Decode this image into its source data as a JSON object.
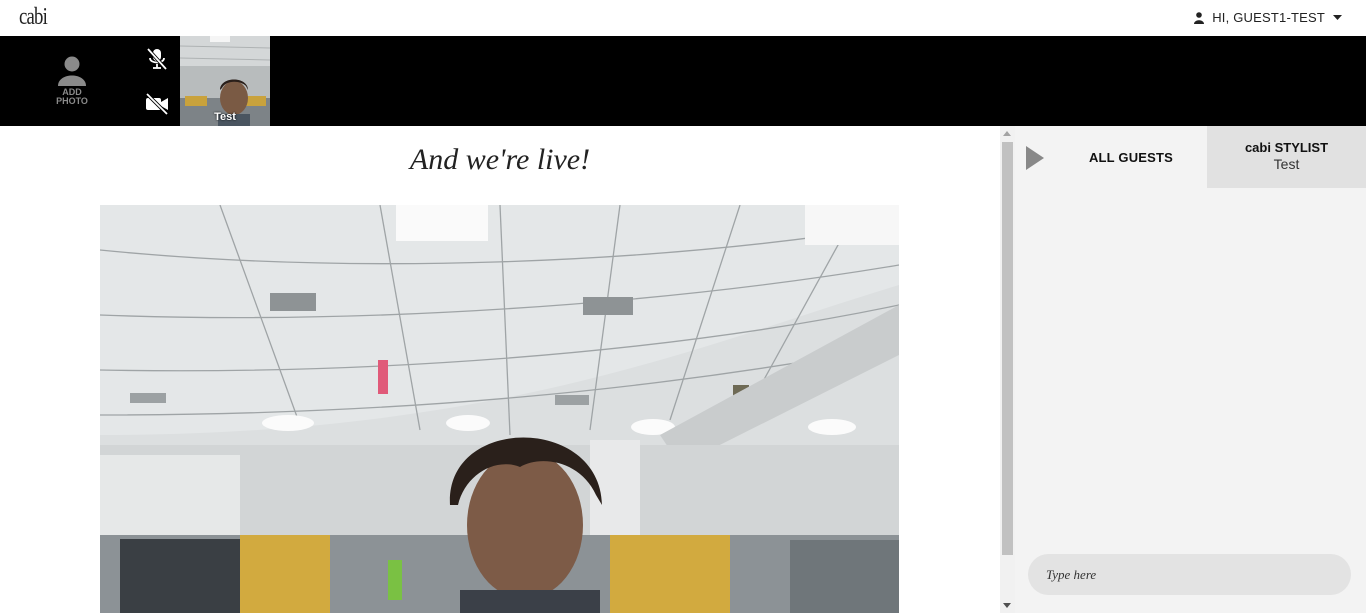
{
  "header": {
    "logo": "cabi",
    "user_greeting": "HI, GUEST1-TEST"
  },
  "strip": {
    "add_photo_line1": "ADD",
    "add_photo_line2": "PHOTO",
    "self_name": "Test",
    "icons": [
      "person-icon",
      "mic-muted-icon",
      "camera-off-icon"
    ]
  },
  "main": {
    "title": "And we're live!"
  },
  "panel": {
    "tab_all": "ALL GUESTS",
    "tab_stylist_title": "cabi STYLIST",
    "tab_stylist_name": "Test",
    "chat_placeholder": "Type here"
  },
  "colors": {
    "strip_bg": "#000000",
    "panel_bg": "#f3f3f3",
    "stylist_tab_bg": "#e1e1e1",
    "chat_input_bg": "#e3e3e3"
  }
}
